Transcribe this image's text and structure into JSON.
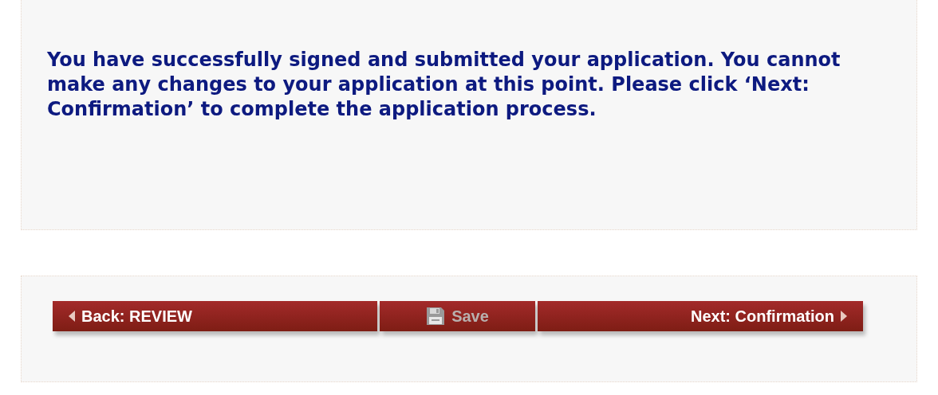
{
  "message": "You have successfully signed and submitted your application. You cannot make any changes to your application at this point. Please click ‘Next: Confirmation’ to complete the application process.",
  "buttons": [
    {
      "kind": "back",
      "label": "Back: REVIEW",
      "disabled": false
    },
    {
      "kind": "save",
      "label": "Save",
      "disabled": true
    },
    {
      "kind": "next",
      "label": "Next: Confirmation",
      "disabled": false
    }
  ]
}
